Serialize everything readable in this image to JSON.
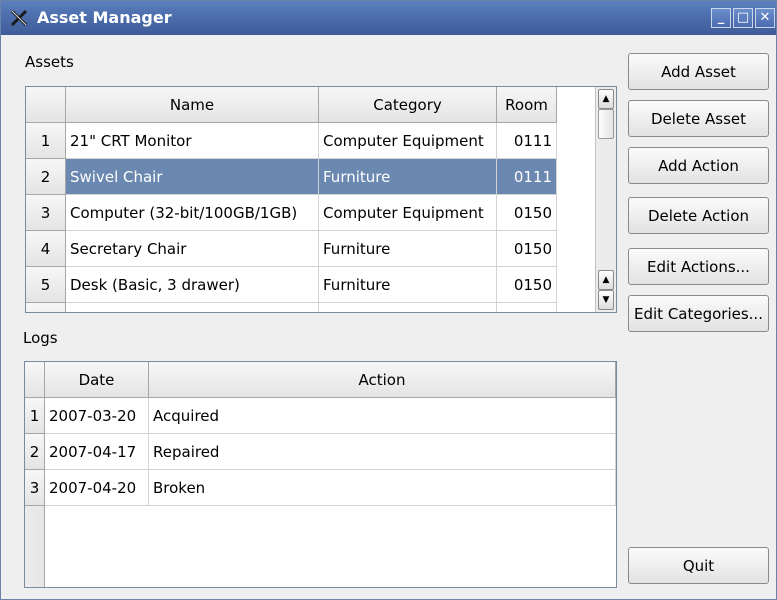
{
  "window": {
    "title": "Asset Manager",
    "minimize": "_",
    "maximize": "□",
    "close": "✕"
  },
  "assets": {
    "label": "Assets",
    "columns": [
      "Name",
      "Category",
      "Room"
    ],
    "rows": [
      {
        "num": "1",
        "name": "21\" CRT Monitor",
        "category": "Computer Equipment",
        "room": "0111"
      },
      {
        "num": "2",
        "name": "Swivel Chair",
        "category": "Furniture",
        "room": "0111"
      },
      {
        "num": "3",
        "name": "Computer (32-bit/100GB/1GB)",
        "category": "Computer Equipment",
        "room": "0150"
      },
      {
        "num": "4",
        "name": "Secretary Chair",
        "category": "Furniture",
        "room": "0150"
      },
      {
        "num": "5",
        "name": "Desk (Basic, 3 drawer)",
        "category": "Furniture",
        "room": "0150"
      }
    ],
    "selected_row": "2"
  },
  "logs": {
    "label": "Logs",
    "columns": [
      "Date",
      "Action"
    ],
    "rows": [
      {
        "num": "1",
        "date": "2007-03-20",
        "action": "Acquired"
      },
      {
        "num": "2",
        "date": "2007-04-17",
        "action": "Repaired"
      },
      {
        "num": "3",
        "date": "2007-04-20",
        "action": "Broken"
      }
    ]
  },
  "buttons": {
    "add_asset": "Add Asset",
    "delete_asset": "Delete Asset",
    "add_action": "Add Action",
    "delete_action": "Delete Action",
    "edit_actions": "Edit Actions...",
    "edit_categories": "Edit Categories...",
    "quit": "Quit"
  },
  "colors": {
    "titlebar": "#4a6aa8",
    "selection": "#6a88b0"
  }
}
